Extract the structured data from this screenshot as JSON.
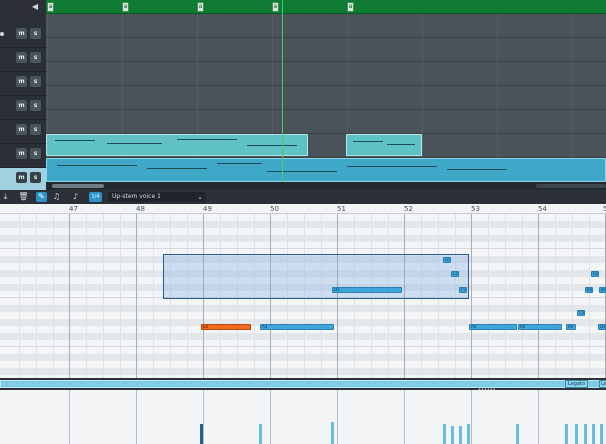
{
  "markers": [
    "a",
    "a",
    "a",
    "a",
    "a"
  ],
  "tracks": [
    {
      "mute": "m",
      "solo": "s"
    },
    {
      "mute": "m",
      "solo": "s"
    },
    {
      "mute": "m",
      "solo": "s"
    },
    {
      "mute": "m",
      "solo": "s"
    },
    {
      "mute": "m",
      "solo": "s"
    },
    {
      "mute": "m",
      "solo": "s"
    },
    {
      "mute": "m",
      "solo": "s"
    }
  ],
  "toolbar": {
    "voice_select": "Up-stem voice 1",
    "icons": [
      "import-icon",
      "delete-icon",
      "edit-tool-icon",
      "note-icon",
      "quantize-icon",
      "step-input-icon"
    ],
    "step_input_label": "1/4"
  },
  "ruler": {
    "bars": [
      "47",
      "48",
      "49",
      "50",
      "51",
      "52",
      "53",
      "54",
      "5"
    ]
  },
  "notes": [
    {
      "label": "E4",
      "active": true
    },
    {
      "label": "A4"
    },
    {
      "label": "A4"
    },
    {
      "label": "A4"
    },
    {
      "label": "A4"
    },
    {
      "label": "D5"
    },
    {
      "label": "G5"
    },
    {
      "label": "C5"
    },
    {
      "label": "F5"
    },
    {
      "label": "G5"
    },
    {
      "label": "B5"
    },
    {
      "label": "B5"
    },
    {
      "label": "C5"
    },
    {
      "label": "D5"
    }
  ],
  "articulation": {
    "tags": [
      "Legato",
      "Le"
    ]
  },
  "colors": {
    "marker_bar": "#0f7a31",
    "playhead": "#43d15f",
    "clip": "#5fc1c4",
    "note": "#3ea6db",
    "note_active": "#f06a1c",
    "selection": "#2e5b8e"
  }
}
